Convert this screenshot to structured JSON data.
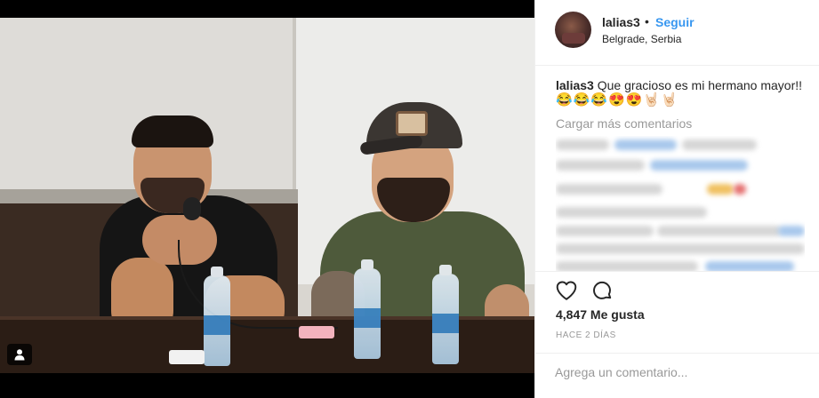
{
  "post": {
    "username": "lalias3",
    "separator": "•",
    "follow_label": "Seguir",
    "location": "Belgrade, Serbia",
    "caption": {
      "username": "lalias3",
      "text": "Que gracioso es mi hermano mayor!!",
      "emojis": "😂😂😂😍😍🤘🏻🤘🏻"
    },
    "load_more_label": "Cargar más comentarios",
    "likes_label": "4,847 Me gusta",
    "time_label": "HACE 2 DÍAS",
    "comment_placeholder": "Agrega un comentario..."
  },
  "icons": {
    "like": "heart-icon",
    "comment": "comment-icon",
    "tag": "user-tag-icon"
  },
  "colors": {
    "accent": "#3897f0",
    "text": "#262626",
    "muted": "#999999"
  }
}
